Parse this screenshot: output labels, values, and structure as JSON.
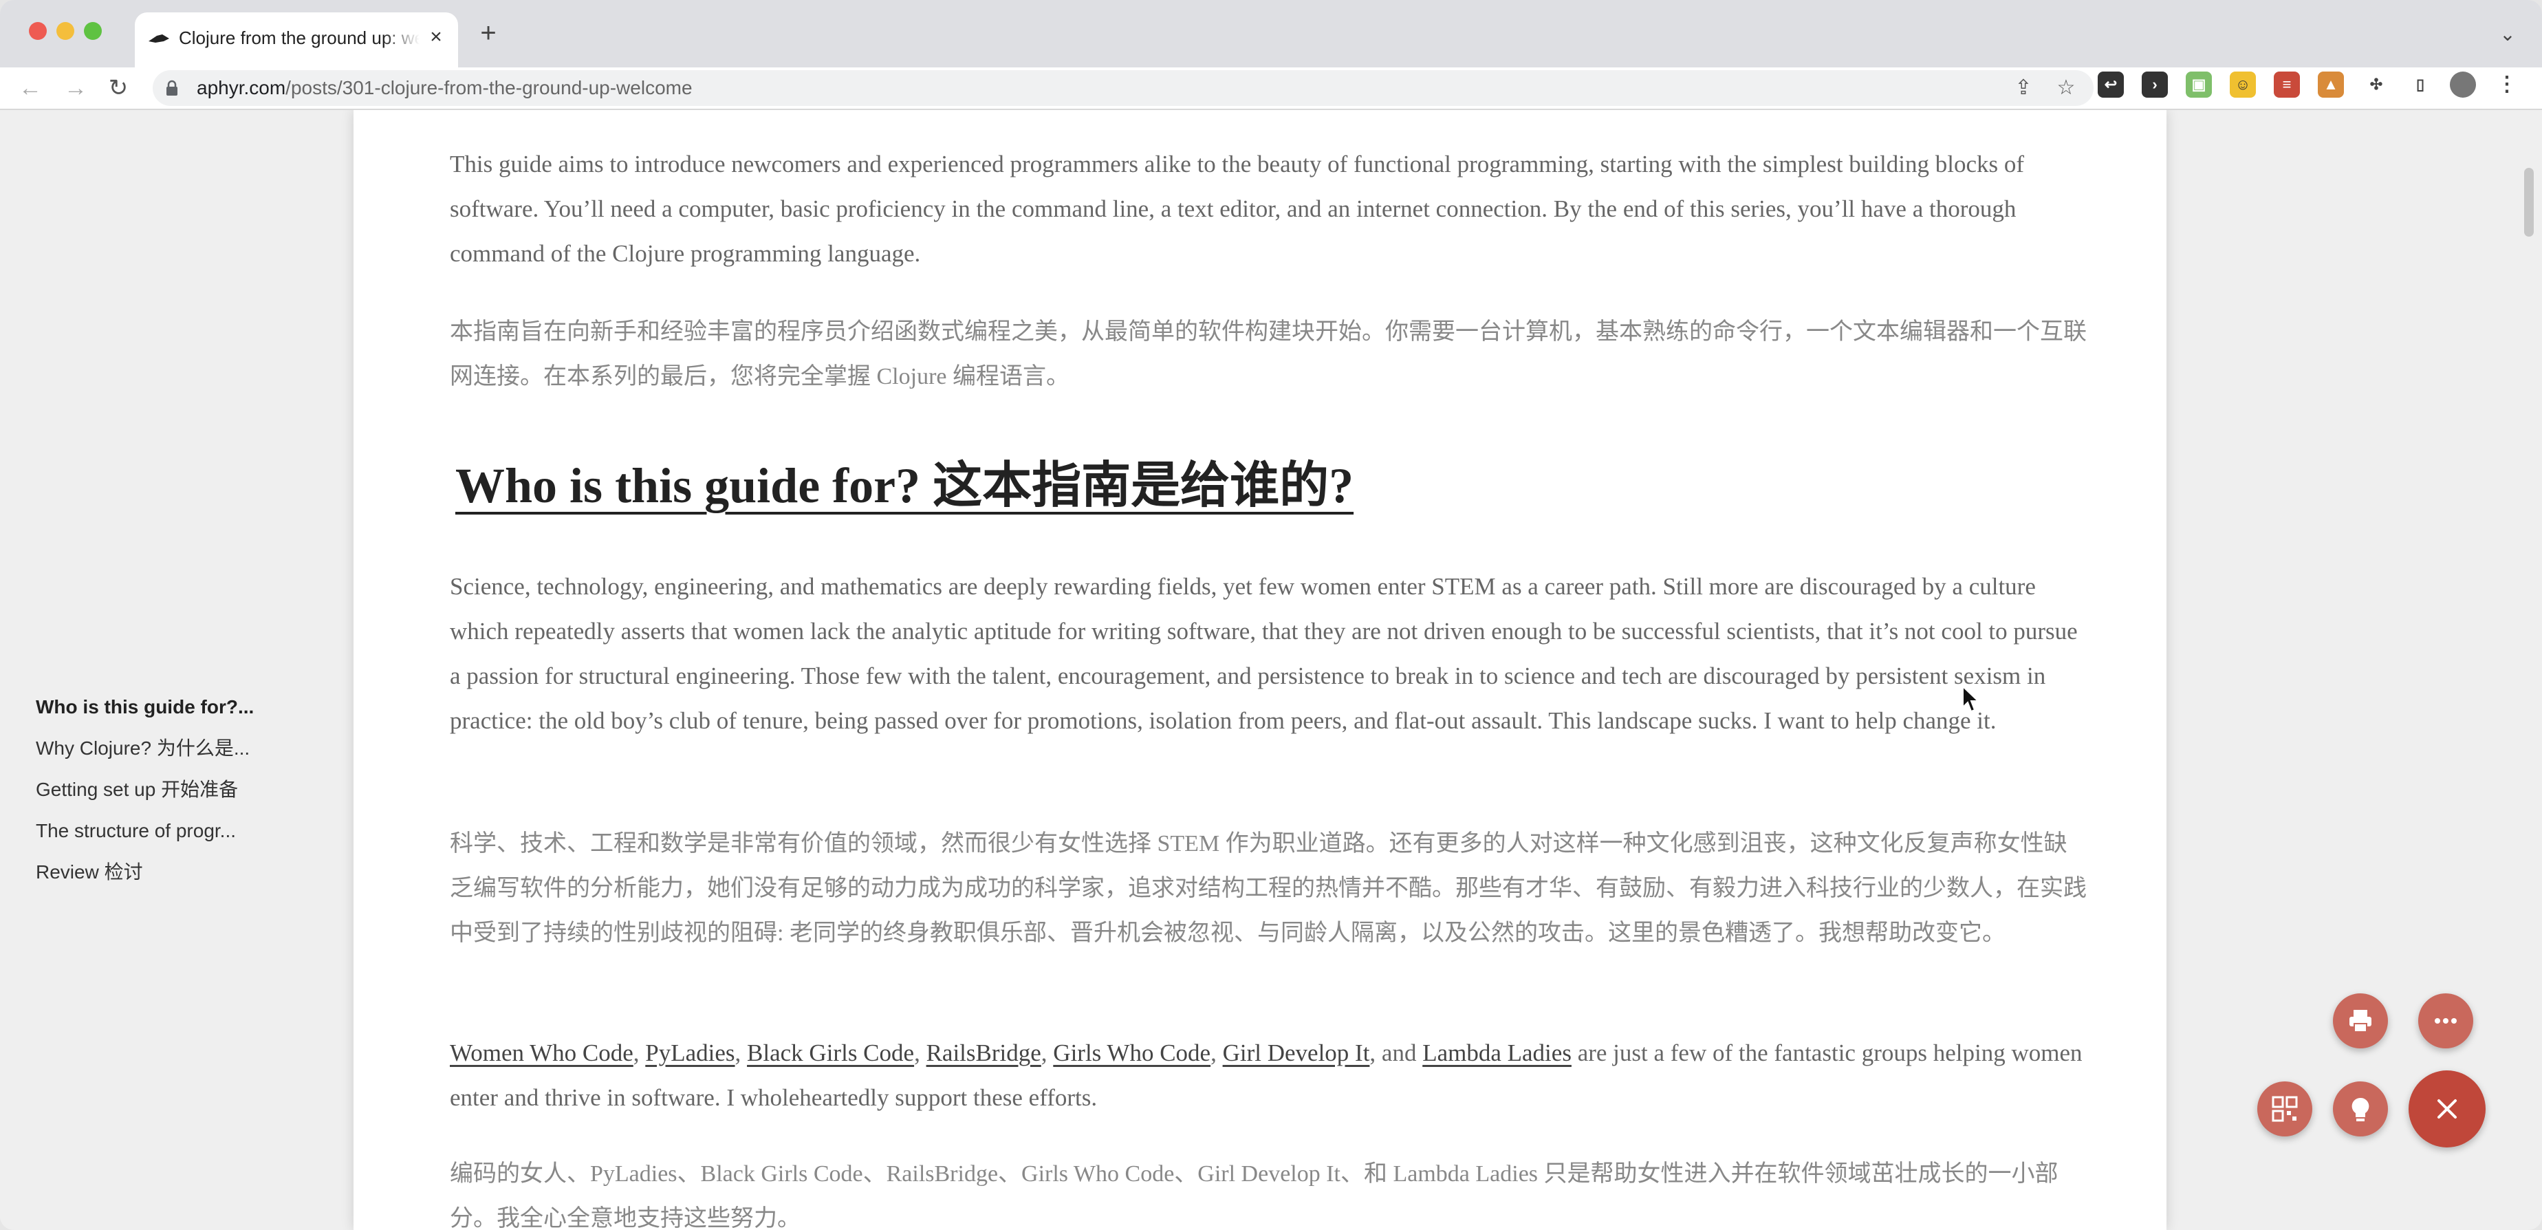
{
  "browser": {
    "tab": {
      "title": "Clojure from the ground up: welcome"
    },
    "url": {
      "host": "aphyr.com",
      "path": "/posts/301-clojure-from-the-ground-up-welcome"
    }
  },
  "toc": {
    "items": [
      {
        "label": "Who is this guide for?...",
        "active": true
      },
      {
        "label": "Why Clojure? 为什么是..."
      },
      {
        "label": "Getting set up 开始准备"
      },
      {
        "label": "The structure of progr..."
      },
      {
        "label": "Review 检讨"
      }
    ]
  },
  "article": {
    "intro_en": "This guide aims to introduce newcomers and experienced programmers alike to the beauty of functional programming, starting with the simplest building blocks of software. You’ll need a computer, basic proficiency in the command line, a text editor, and an internet connection. By the end of this series, you’ll have a thorough command of the Clojure programming language.",
    "intro_zh": "本指南旨在向新手和经验丰富的程序员介绍函数式编程之美，从最简单的软件构建块开始。你需要一台计算机，基本熟练的命令行，一个文本编辑器和一个互联网连接。在本系列的最后，您将完全掌握 Clojure 编程语言。",
    "heading": "Who is this guide for? 这本指南是给谁的? ",
    "stem_en": "Science, technology, engineering, and mathematics are deeply rewarding fields, yet few women enter STEM as a career path. Still more are discouraged by a culture which repeatedly asserts that women lack the analytic aptitude for writing software, that they are not driven enough to be successful scientists, that it’s not cool to pursue a passion for structural engineering. Those few with the talent, encouragement, and persistence to break in to science and tech are discouraged by persistent sexism in practice: the old boy’s club of tenure, being passed over for promotions, isolation from peers, and flat-out assault. This landscape sucks. I want to help change it.",
    "stem_zh": "科学、技术、工程和数学是非常有价值的领域，然而很少有女性选择 STEM 作为职业道路。还有更多的人对这样一种文化感到沮丧，这种文化反复声称女性缺乏编写软件的分析能力，她们没有足够的动力成为成功的科学家，追求对结构工程的热情并不酷。那些有才华、有鼓励、有毅力进入科技行业的少数人，在实践中受到了持续的性别歧视的阻碍: 老同学的终身教职俱乐部、晋升机会被忽视、与同龄人隔离，以及公然的攻击。这里的景色糟透了。我想帮助改变它。",
    "links": [
      "Women Who Code",
      "PyLadies",
      "Black Girls Code",
      "RailsBridge",
      "Girls Who Code",
      "Girl Develop It",
      "Lambda Ladies"
    ],
    "links_sep": ", ",
    "links_and": ", and ",
    "links_tail": " are just a few of the fantastic groups helping women enter and thrive in software. I wholeheartedly support these efforts.",
    "groups_zh": "编码的女人、PyLadies、Black Girls Code、RailsBridge、Girls Who Code、Girl Develop It、和 Lambda Ladies 只是帮助女性进入并在软件领域茁壮成长的一小部分。我全心全意地支持这些努力。"
  },
  "colors": {
    "fab": "#c9685c",
    "fab_close": "#c0473a",
    "tab_strip": "#dedfe3"
  },
  "fabs": [
    "print-icon",
    "more-icon",
    "qr-code-icon",
    "lightbulb-icon",
    "close-icon"
  ]
}
